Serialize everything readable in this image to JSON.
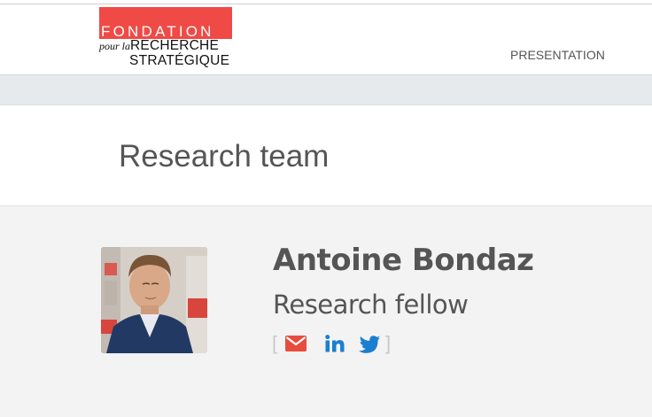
{
  "header": {
    "logo": {
      "line1": "FONDATION",
      "line2_prefix": "pour la",
      "line2_main": "RECHERCHE",
      "line3": "STRATÉGIQUE",
      "brand_color": "#ef4a45"
    },
    "nav": {
      "presentation_label": "PRESENTATION"
    }
  },
  "page": {
    "title": "Research team"
  },
  "member": {
    "name": "Antoine Bondaz",
    "role": "Research fellow",
    "social": {
      "open_bracket": "[",
      "close_bracket": "]",
      "icons": [
        "email-icon",
        "linkedin-icon",
        "twitter-icon"
      ],
      "email_color": "#e84c3d",
      "link_color": "#1a7fd1"
    }
  }
}
